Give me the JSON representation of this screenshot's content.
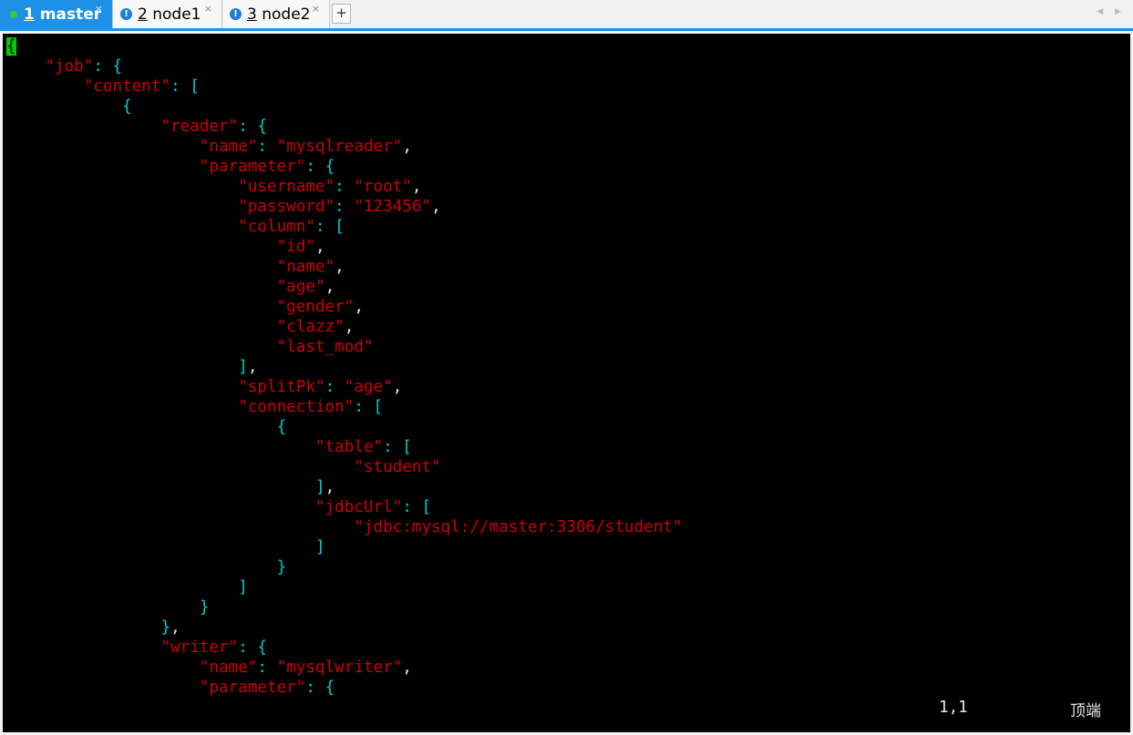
{
  "tabs": [
    {
      "num": "1",
      "name": "master",
      "active": true,
      "status": "connected-dot-icon",
      "close": "×"
    },
    {
      "num": "2",
      "name": "node1",
      "active": false,
      "status": "info-icon",
      "close": "×"
    },
    {
      "num": "3",
      "name": "node2",
      "active": false,
      "status": "info-icon",
      "close": "×"
    }
  ],
  "new_tab_label": "+",
  "nav_arrows": "◀ ▶",
  "colors": {
    "string": "#cd0000",
    "punct": "#00cdcd",
    "cursor": "#00cd00",
    "tab_active": "#1e90e6"
  },
  "editor": {
    "lines": [
      [
        [
          "c",
          "{"
        ]
      ],
      [
        [
          "t",
          "    "
        ],
        [
          "s",
          "\"job\""
        ],
        [
          "p",
          ": {"
        ]
      ],
      [
        [
          "t",
          "        "
        ],
        [
          "s",
          "\"content\""
        ],
        [
          "p",
          ": ["
        ]
      ],
      [
        [
          "t",
          "            "
        ],
        [
          "p",
          "{"
        ]
      ],
      [
        [
          "t",
          "                "
        ],
        [
          "s",
          "\"reader\""
        ],
        [
          "p",
          ": {"
        ]
      ],
      [
        [
          "t",
          "                    "
        ],
        [
          "s",
          "\"name\""
        ],
        [
          "p",
          ": "
        ],
        [
          "s",
          "\"mysqlreader\""
        ],
        [
          "t",
          ","
        ]
      ],
      [
        [
          "t",
          "                    "
        ],
        [
          "s",
          "\"parameter\""
        ],
        [
          "p",
          ": {"
        ]
      ],
      [
        [
          "t",
          "                        "
        ],
        [
          "s",
          "\"username\""
        ],
        [
          "p",
          ": "
        ],
        [
          "s",
          "\"root\""
        ],
        [
          "t",
          ","
        ]
      ],
      [
        [
          "t",
          "                        "
        ],
        [
          "s",
          "\"password\""
        ],
        [
          "p",
          ": "
        ],
        [
          "s",
          "\"123456\""
        ],
        [
          "t",
          ","
        ]
      ],
      [
        [
          "t",
          "                        "
        ],
        [
          "s",
          "\"column\""
        ],
        [
          "p",
          ": ["
        ]
      ],
      [
        [
          "t",
          "                            "
        ],
        [
          "s",
          "\"id\""
        ],
        [
          "t",
          ","
        ]
      ],
      [
        [
          "t",
          "                            "
        ],
        [
          "s",
          "\"name\""
        ],
        [
          "t",
          ","
        ]
      ],
      [
        [
          "t",
          "                            "
        ],
        [
          "s",
          "\"age\""
        ],
        [
          "t",
          ","
        ]
      ],
      [
        [
          "t",
          "                            "
        ],
        [
          "s",
          "\"gender\""
        ],
        [
          "t",
          ","
        ]
      ],
      [
        [
          "t",
          "                            "
        ],
        [
          "s",
          "\"clazz\""
        ],
        [
          "t",
          ","
        ]
      ],
      [
        [
          "t",
          "                            "
        ],
        [
          "s",
          "\"last_mod\""
        ]
      ],
      [
        [
          "t",
          "                        "
        ],
        [
          "p",
          "]"
        ],
        [
          "t",
          ","
        ]
      ],
      [
        [
          "t",
          "                        "
        ],
        [
          "s",
          "\"splitPk\""
        ],
        [
          "p",
          ": "
        ],
        [
          "s",
          "\"age\""
        ],
        [
          "t",
          ","
        ]
      ],
      [
        [
          "t",
          "                        "
        ],
        [
          "s",
          "\"connection\""
        ],
        [
          "p",
          ": ["
        ]
      ],
      [
        [
          "t",
          "                            "
        ],
        [
          "p",
          "{"
        ]
      ],
      [
        [
          "t",
          "                                "
        ],
        [
          "s",
          "\"table\""
        ],
        [
          "p",
          ": ["
        ]
      ],
      [
        [
          "t",
          "                                    "
        ],
        [
          "s",
          "\"student\""
        ]
      ],
      [
        [
          "t",
          "                                "
        ],
        [
          "p",
          "]"
        ],
        [
          "t",
          ","
        ]
      ],
      [
        [
          "t",
          "                                "
        ],
        [
          "s",
          "\"jdbcUrl\""
        ],
        [
          "p",
          ": ["
        ]
      ],
      [
        [
          "t",
          "                                    "
        ],
        [
          "s",
          "\"jdbc:mysql://master:3306/student\""
        ]
      ],
      [
        [
          "t",
          "                                "
        ],
        [
          "p",
          "]"
        ]
      ],
      [
        [
          "t",
          "                            "
        ],
        [
          "p",
          "}"
        ]
      ],
      [
        [
          "t",
          "                        "
        ],
        [
          "p",
          "]"
        ]
      ],
      [
        [
          "t",
          "                    "
        ],
        [
          "p",
          "}"
        ]
      ],
      [
        [
          "t",
          "                "
        ],
        [
          "p",
          "}"
        ],
        [
          "t",
          ","
        ]
      ],
      [
        [
          "t",
          "                "
        ],
        [
          "s",
          "\"writer\""
        ],
        [
          "p",
          ": {"
        ]
      ],
      [
        [
          "t",
          "                    "
        ],
        [
          "s",
          "\"name\""
        ],
        [
          "p",
          ": "
        ],
        [
          "s",
          "\"mysqlwriter\""
        ],
        [
          "t",
          ","
        ]
      ],
      [
        [
          "t",
          "                    "
        ],
        [
          "s",
          "\"parameter\""
        ],
        [
          "p",
          ": {"
        ]
      ]
    ],
    "cursor_position": "1,1",
    "scroll_position": "顶端"
  }
}
